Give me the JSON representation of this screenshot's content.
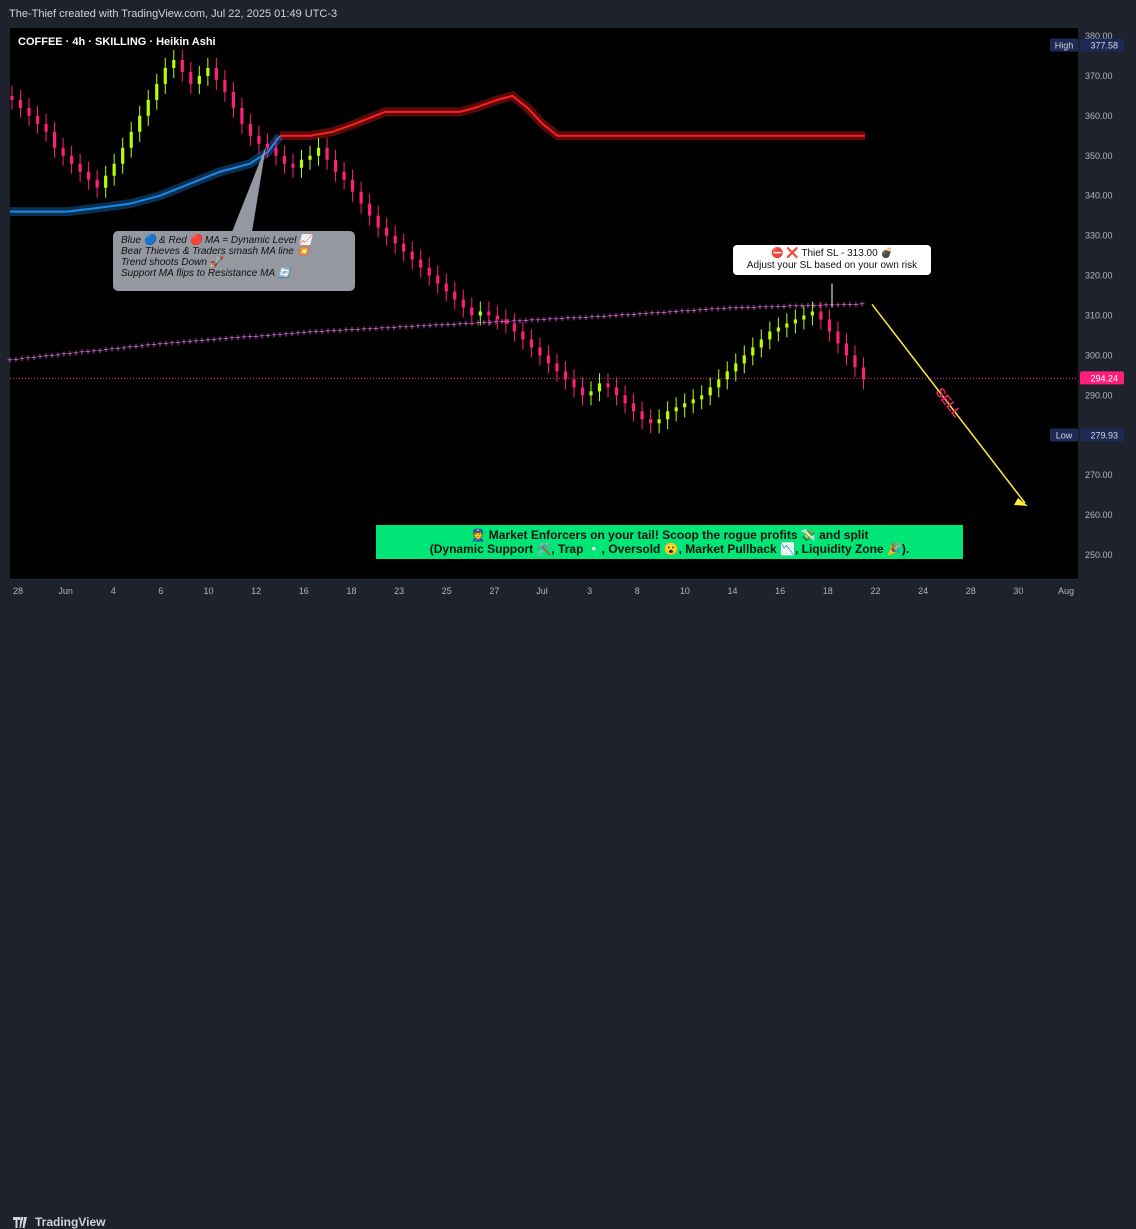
{
  "credit": "The-Thief created with TradingView.com, Jul 22, 2025 01:49 UTC-3",
  "footer_brand": "TradingView",
  "chart_data": {
    "type": "candlestick",
    "title": "COFFEE · 4h · SKILLING · Heikin Ashi",
    "symbol": "COFFEE",
    "interval": "4h",
    "chart_style": "Heikin Ashi",
    "ylim": [
      244,
      382
    ],
    "y_ticks": [
      "380.00",
      "370.00",
      "360.00",
      "350.00",
      "340.00",
      "330.00",
      "320.00",
      "310.00",
      "300.00",
      "290.00",
      "280.00",
      "270.00",
      "260.00",
      "250.00"
    ],
    "x_ticks": [
      "28",
      "Jun",
      "4",
      "6",
      "10",
      "12",
      "16",
      "18",
      "23",
      "25",
      "27",
      "Jul",
      "3",
      "8",
      "10",
      "14",
      "16",
      "18",
      "22",
      "24",
      "28",
      "30",
      "Aug"
    ],
    "price_labels": {
      "high": {
        "label": "High",
        "value": "377.58"
      },
      "last": {
        "value": "294.24"
      },
      "low": {
        "label": "Low",
        "value": "279.93"
      }
    },
    "candle_closes": [
      364,
      362,
      360,
      358,
      356,
      352,
      350,
      348,
      346,
      344,
      342,
      345,
      348,
      352,
      356,
      360,
      364,
      368,
      372,
      374,
      371,
      368,
      370,
      372,
      369,
      366,
      362,
      358,
      355,
      353,
      352,
      350,
      348,
      347,
      349,
      350,
      352,
      349,
      346,
      344,
      341,
      338,
      335,
      332,
      330,
      328,
      326,
      324,
      322,
      320,
      318,
      316,
      314,
      312,
      310,
      311,
      310,
      309,
      308,
      306,
      304,
      302,
      300,
      298,
      296,
      294,
      292,
      290,
      291,
      293,
      292,
      290,
      288,
      286,
      284,
      283,
      284,
      286,
      287,
      288,
      289,
      290,
      292,
      294,
      296,
      298,
      300,
      302,
      304,
      306,
      307,
      308,
      309,
      310,
      311,
      309,
      306,
      303,
      300,
      297,
      294
    ],
    "bull_color": "#b6ff00",
    "bear_color": "#ff1f7a",
    "blue_ma": {
      "name": "Blue MA",
      "color": "#1e88e5",
      "points": [
        [
          0,
          336
        ],
        [
          38,
          336
        ],
        [
          60,
          337
        ],
        [
          80,
          338
        ],
        [
          100,
          340
        ],
        [
          120,
          343
        ],
        [
          140,
          346
        ],
        [
          160,
          348
        ],
        [
          172,
          351
        ],
        [
          180,
          355
        ]
      ]
    },
    "red_ma": {
      "name": "Red MA",
      "color": "#ff1f1f",
      "points": [
        [
          180,
          355
        ],
        [
          200,
          355
        ],
        [
          215,
          356
        ],
        [
          230,
          358
        ],
        [
          250,
          361
        ],
        [
          275,
          361
        ],
        [
          300,
          361
        ],
        [
          310,
          362
        ],
        [
          325,
          364
        ],
        [
          335,
          365
        ],
        [
          345,
          362
        ],
        [
          355,
          358
        ],
        [
          365,
          355
        ],
        [
          470,
          355
        ],
        [
          570,
          355
        ]
      ]
    },
    "dotted_line": {
      "color": "#ff7bff",
      "points": [
        [
          0,
          299
        ],
        [
          100,
          303
        ],
        [
          200,
          306
        ],
        [
          300,
          308
        ],
        [
          400,
          310
        ],
        [
          480,
          312
        ],
        [
          570,
          313
        ]
      ]
    },
    "annotations": {
      "callout_lines": [
        "Blue 🔵 & Red 🔴 MA = Dynamic Level 📈",
        "Bear Thieves & Traders smash MA line 💥",
        "Trend shoots Down 🚀",
        "Support MA flips to Resistance MA 🔄"
      ],
      "sl_lines": [
        "⛔ ❌ Thief SL - 313.00 💣",
        "Adjust your SL based on your own risk"
      ],
      "sell_label": "SELL",
      "banner_lines": [
        "👮 Market Enforcers on your tail! Scoop the rogue profits 💸 and split",
        "(Dynamic Support 🛠️, Trap ▫️, Oversold 😮, Market Pullback 📉, Liquidity Zone 🎉)."
      ]
    }
  }
}
